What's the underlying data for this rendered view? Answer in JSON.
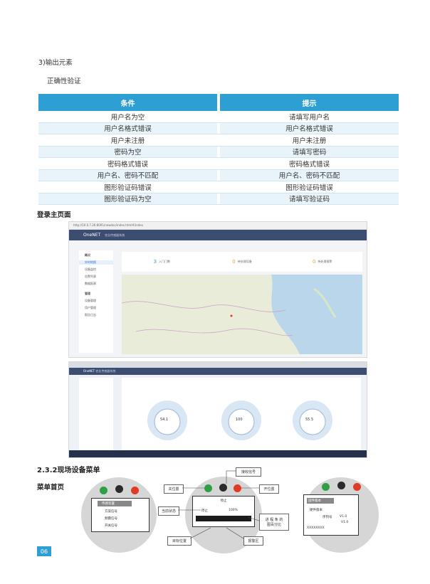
{
  "section_output": "3)输出元素",
  "subheading": "正确性验证",
  "table": {
    "headers": [
      "条件",
      "提示"
    ],
    "rows": [
      [
        "用户名为空",
        "请填写用户名"
      ],
      [
        "用户名格式错误",
        "用户名格式错误"
      ],
      [
        "用户未注册",
        "用户未注册"
      ],
      [
        "密码为空",
        "请填写密码"
      ],
      [
        "密码格式错误",
        "密码格式错误"
      ],
      [
        "用户名、密码不匹配",
        "用户名、密码不匹配"
      ],
      [
        "图形验证码错误",
        "图形验证码错误"
      ],
      [
        "图形验证码为空",
        "请填写验证码"
      ]
    ]
  },
  "login_heading": "登录主页面",
  "screenshot1": {
    "url": "http://10.0.7.26:8091/newdoc/index.html#/index",
    "brand": "OneNET",
    "brand_sub": "农业传感器系统",
    "sidebar": [
      "概况",
      "实时地图",
      "设备监控",
      "告警列表",
      "数据报表",
      "管理",
      "设备管理",
      "用户管理",
      "报告日志"
    ],
    "cards": [
      {
        "num": "3",
        "label": "入门门数"
      },
      {
        "num": "0",
        "label": "待处理设备"
      },
      {
        "num": "0",
        "label": "待处理报警"
      }
    ]
  },
  "screenshot2": {
    "brand": "OneNET",
    "brand_sub": "农业传感器系统",
    "gauges": [
      "54.1",
      "100",
      "55.5"
    ],
    "gauge_sub": [
      "54.1",
      "100",
      "55.5"
    ]
  },
  "section_232": "2.3.2现场设备菜单",
  "menu_home": "菜单首页",
  "diagram": {
    "menu1": [
      "传感装置",
      "方案信号",
      "频震信号",
      "开关信号"
    ],
    "labels": {
      "receive": "接收信号",
      "close": "关位置",
      "open": "开位置",
      "current": "当前状态",
      "curve": "进 程 条 的\n图百分比",
      "target": "目标位置",
      "alarm": "报警区"
    },
    "screen2_title": "停止",
    "screen2_value": "100%",
    "screen3": {
      "title": "固件版本",
      "sub": "硬件版本",
      "ver_label": "序列号",
      "v1": "V1.0",
      "v2": "V1.0",
      "serial": "XXXXXXXX"
    }
  },
  "page_number": "06"
}
